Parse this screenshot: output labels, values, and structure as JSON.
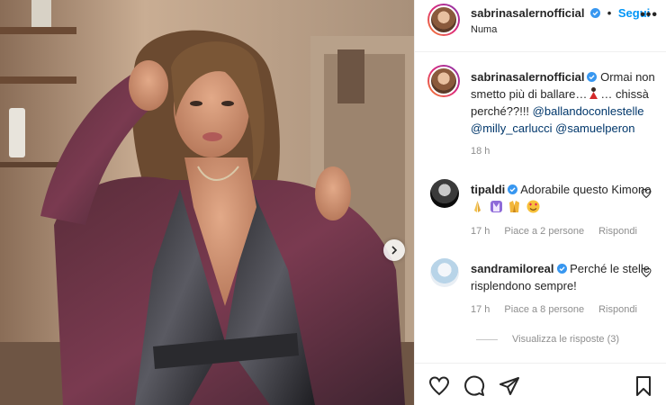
{
  "post": {
    "author": "sabrinasalernofficial",
    "location": "Numa",
    "follow_label": "Segui",
    "more_label": "•••"
  },
  "caption": {
    "author": "sabrinasalernofficial",
    "text_1": "Ormai non smetto più di ballare…",
    "text_2": "… chissà perché??!!!",
    "mention_1": "@ballandoconlestelle",
    "mention_2": "@milly_carlucci",
    "mention_3": "@samuelperon",
    "time": "18 h"
  },
  "comments": [
    {
      "user": "tipaldi",
      "text": "Adorabile questo Kimono",
      "emojis": [
        "folded-hands",
        "kimono",
        "kimono",
        "heart-eyes"
      ],
      "time": "17 h",
      "likes": "Piace a 2 persone",
      "reply_label": "Rispondi"
    },
    {
      "user": "sandramiloreal",
      "text": "Perché le stelle risplendono sempre!",
      "time": "17 h",
      "likes": "Piace a 8 persone",
      "reply_label": "Rispondi"
    }
  ],
  "replies_label": "Visualizza le risposte (3)",
  "icons": {
    "verified": "verified-badge-icon",
    "like": "heart-icon",
    "comment": "comment-bubble-icon",
    "share": "paper-plane-icon",
    "save": "bookmark-icon",
    "next": "chevron-right-icon"
  },
  "colors": {
    "link": "#0095f6",
    "mention": "#00376b",
    "meta": "#8e8e8e",
    "text": "#262626"
  }
}
